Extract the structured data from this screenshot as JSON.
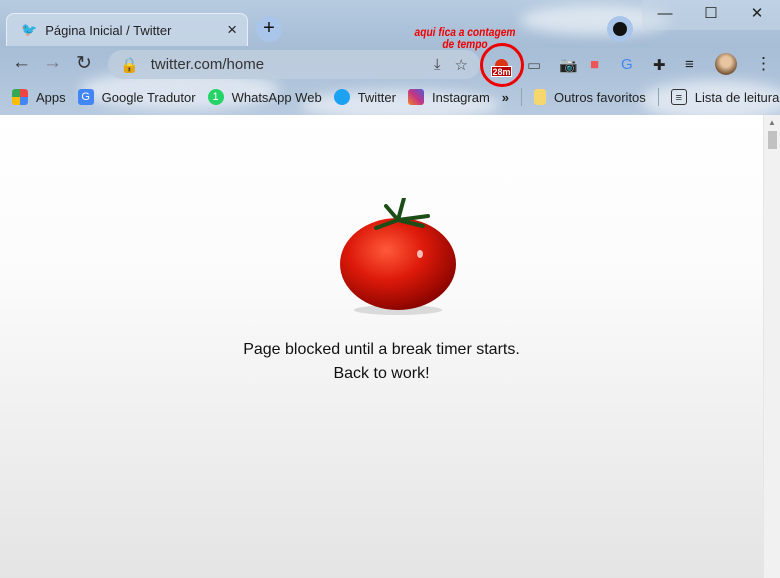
{
  "tab": {
    "title": "Página Inicial / Twitter",
    "close": "×",
    "new_tab": "+"
  },
  "window": {
    "minimize": "—",
    "maximize": "☐",
    "close": "✕"
  },
  "toolbar": {
    "back": "←",
    "forward": "→",
    "reload": "↻",
    "url": "twitter.com/home",
    "timer_badge": "28m",
    "menu": "⋮"
  },
  "annotation": "aqui fica a contagem de tempo",
  "bookmarks": [
    {
      "label": "Apps",
      "color": "#e44"
    },
    {
      "label": "Google Tradutor",
      "color": "#4285f4"
    },
    {
      "label": "WhatsApp Web",
      "color": "#25d366"
    },
    {
      "label": "Twitter",
      "color": "#1da1f2"
    },
    {
      "label": "Instagram",
      "color": "#c13584"
    }
  ],
  "bookmarks_more": "»",
  "other_bookmarks": "Outros favoritos",
  "reading_list": "Lista de leitura",
  "page": {
    "line1": "Page blocked until a break timer starts.",
    "line2": "Back to work!"
  }
}
